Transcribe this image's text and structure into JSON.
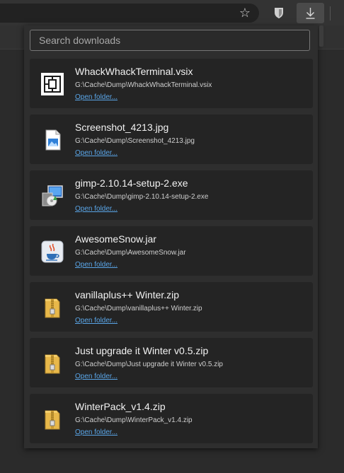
{
  "toolbar": {
    "bookmark_icon": "star-outline-icon",
    "extension_icon": "bitwarden-shield-icon",
    "downloads_icon": "download-arrow-icon"
  },
  "search": {
    "placeholder": "Search downloads"
  },
  "downloads": [
    {
      "name": "WhackWhackTerminal.vsix",
      "path": "G:\\Cache\\Dump\\WhackWhackTerminal.vsix",
      "action": "Open folder...",
      "icon": "vsix-package-icon"
    },
    {
      "name": "Screenshot_4213.jpg",
      "path": "G:\\Cache\\Dump\\Screenshot_4213.jpg",
      "action": "Open folder...",
      "icon": "image-file-icon"
    },
    {
      "name": "gimp-2.10.14-setup-2.exe",
      "path": "G:\\Cache\\Dump\\gimp-2.10.14-setup-2.exe",
      "action": "Open folder...",
      "icon": "installer-exe-icon"
    },
    {
      "name": "AwesomeSnow.jar",
      "path": "G:\\Cache\\Dump\\AwesomeSnow.jar",
      "action": "Open folder...",
      "icon": "java-jar-icon"
    },
    {
      "name": "vanillaplus++ Winter.zip",
      "path": "G:\\Cache\\Dump\\vanillaplus++ Winter.zip",
      "action": "Open folder...",
      "icon": "zip-archive-icon"
    },
    {
      "name": "Just upgrade it Winter v0.5.zip",
      "path": "G:\\Cache\\Dump\\Just upgrade it Winter v0.5.zip",
      "action": "Open folder...",
      "icon": "zip-archive-icon"
    },
    {
      "name": "WinterPack_v1.4.zip",
      "path": "G:\\Cache\\Dump\\WinterPack_v1.4.zip",
      "action": "Open folder...",
      "icon": "zip-archive-icon"
    }
  ]
}
